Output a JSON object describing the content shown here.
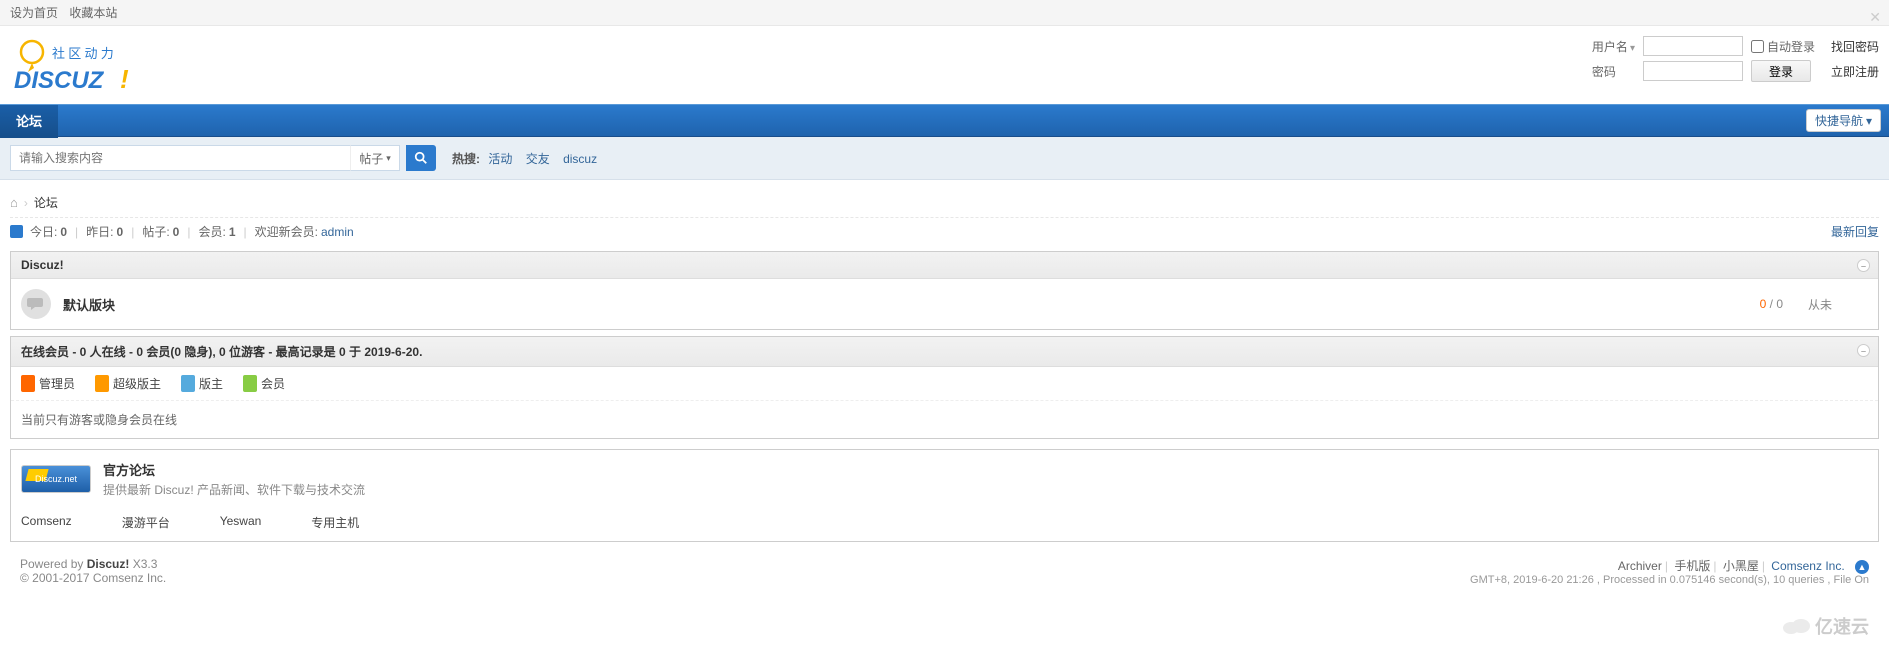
{
  "topbar": {
    "set_home": "设为首页",
    "favorite": "收藏本站"
  },
  "login": {
    "username_label": "用户名",
    "password_label": "密码",
    "auto_login": "自动登录",
    "forgot": "找回密码",
    "login_btn": "登录",
    "register": "立即注册"
  },
  "nav": {
    "forum": "论坛",
    "quick_nav": "快捷导航"
  },
  "search": {
    "placeholder": "请输入搜索内容",
    "type": "帖子",
    "hot_label": "热搜:",
    "hot": [
      "活动",
      "交友",
      "discuz"
    ]
  },
  "breadcrumb": {
    "forum": "论坛"
  },
  "stats": {
    "today_label": "今日:",
    "today": "0",
    "yesterday_label": "昨日:",
    "yesterday": "0",
    "posts_label": "帖子:",
    "posts": "0",
    "members_label": "会员:",
    "members": "1",
    "welcome_label": "欢迎新会员:",
    "newmember": "admin",
    "latest_reply": "最新回复"
  },
  "category": {
    "name": "Discuz!"
  },
  "forum": {
    "name": "默认版块",
    "threads": "0",
    "posts": "0",
    "last": "从未"
  },
  "online": {
    "header": "在线会员 - 0 人在线 - 0 会员(0 隐身), 0 位游客 - 最高记录是 0 于 2019-6-20.",
    "admin": "管理员",
    "super": "超级版主",
    "mod": "版主",
    "member": "会员",
    "msg": "当前只有游客或隐身会员在线"
  },
  "official": {
    "title": "官方论坛",
    "desc": "提供最新 Discuz! 产品新闻、软件下载与技术交流",
    "img_text": "Discuz.net",
    "links": [
      "Comsenz",
      "漫游平台",
      "Yeswan",
      "专用主机"
    ]
  },
  "footer": {
    "powered_by": "Powered by ",
    "discuz": "Discuz!",
    "version": " X3.3",
    "copyright": "© 2001-2017 Comsenz Inc.",
    "archiver": "Archiver",
    "mobile": "手机版",
    "blackhouse": "小黑屋",
    "comsenz": "Comsenz Inc.",
    "debug": "GMT+8, 2019-6-20 21:26 , Processed in 0.075146 second(s), 10 queries , File On"
  },
  "watermark": "亿速云"
}
